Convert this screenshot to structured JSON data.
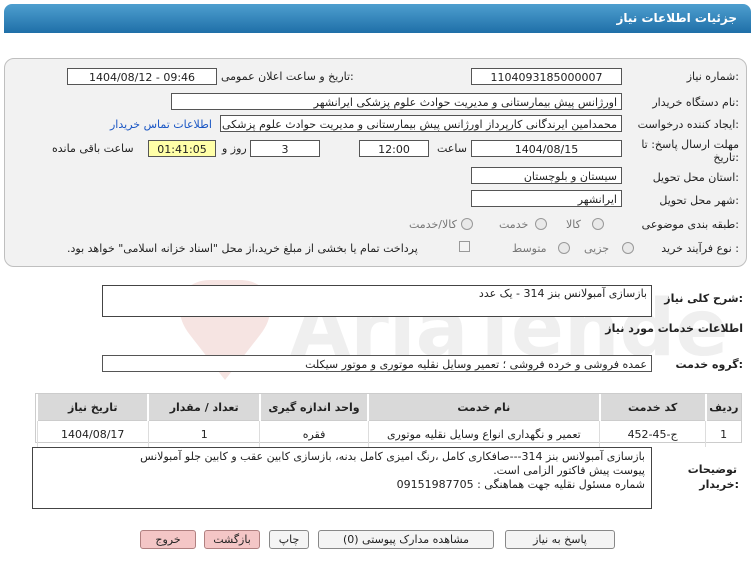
{
  "header": {
    "title": "جزئیات اطلاعات نیاز"
  },
  "form": {
    "need_number_label": "شماره نیاز:",
    "need_number": "1104093185000007",
    "announce_label": "تاریخ و ساعت اعلان عمومی:",
    "announce_value": "1404/08/12 - 09:46",
    "buyer_org_label": "نام دستگاه خریدار:",
    "buyer_org": "اورژانس پیش بیمارستانی و مدیریت حوادث علوم پزشکی ایرانشهر",
    "creator_label": "ایجاد کننده درخواست:",
    "creator": "محمدامین ایرندگانی کارپرداز اورژانس پیش بیمارستانی و مدیریت حوادث علوم پزشکی ایرانشهر",
    "contact_link": "اطلاعات تماس خریدار",
    "deadline_label_1": "مهلت ارسال پاسخ: تا",
    "deadline_label_2": "تاریخ:",
    "deadline_date": "1404/08/15",
    "time_label": "ساعت",
    "deadline_time": "12:00",
    "days_value": "3",
    "days_label": "روز و",
    "remaining_time": "01:41:05",
    "remaining_label": "ساعت باقی مانده",
    "province_label": "استان محل تحویل:",
    "province": "سیستان و بلوچستان",
    "city_label": "شهر محل تحویل:",
    "city": "ایرانشهر",
    "category_label": "طبقه بندی موضوعی:",
    "category_options": [
      "کالا",
      "خدمت",
      "کالا/خدمت"
    ],
    "process_label": "نوع فرآیند خرید :",
    "process_options": [
      "جزیی",
      "متوسط"
    ],
    "payment_note": "پرداخت تمام یا بخشی از مبلغ خرید،از محل \"اسناد خزانه اسلامی\" خواهد بود."
  },
  "summary": {
    "label": "شرح کلی نیاز:",
    "value": "بازسازی آمبولانس بنز 314 - یک عدد"
  },
  "services": {
    "section_title": "اطلاعات خدمات مورد نیاز",
    "group_label": "گروه خدمت:",
    "group_value": "عمده فروشی و خرده فروشی ؛ تعمیر وسایل نقلیه موتوری و موتور سیکلت",
    "columns": [
      "ردیف",
      "کد خدمت",
      "نام خدمت",
      "واحد اندازه گیری",
      "تعداد / مقدار",
      "تاریخ نیاز"
    ],
    "rows": [
      [
        "1",
        "ج-45-452",
        "تعمیر و نگهداری انواع وسایل نقلیه موتوری",
        "فقره",
        "1",
        "1404/08/17"
      ]
    ]
  },
  "notes": {
    "label_1": "توضیحات",
    "label_2": "خریدار:",
    "lines": [
      "بازسازی آمبولانس بنز 314---صافکاری کامل ،رنگ امیزی کامل بدنه، بازسازی کابین عقب و کابین جلو آمبولانس",
      "پیوست پیش فاکتور الزامی است.",
      "شماره مسئول نقلیه جهت هماهنگی : 09151987705"
    ]
  },
  "buttons": {
    "reply": "پاسخ به نیاز",
    "docs": "مشاهده مدارک پیوستی (0)",
    "print": "چاپ",
    "back": "بازگشت",
    "exit": "خروج"
  },
  "watermark": "AriaTender.net"
}
